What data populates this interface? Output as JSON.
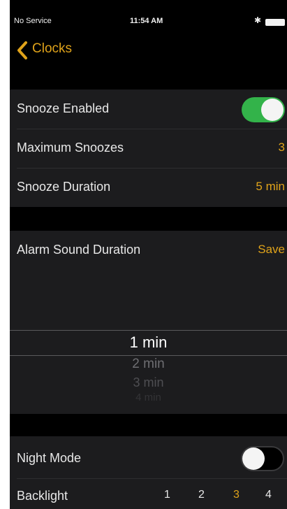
{
  "status_bar": {
    "carrier": "No Service",
    "time": "11:54 AM",
    "bluetooth_icon": "bluetooth-icon",
    "battery_icon": "battery-icon"
  },
  "nav": {
    "back_label": "Clocks",
    "back_icon": "chevron-left-icon"
  },
  "snooze": {
    "enabled_label": "Snooze Enabled",
    "enabled": true,
    "max_label": "Maximum Snoozes",
    "max_value": "3",
    "duration_label": "Snooze Duration",
    "duration_value": "5 min"
  },
  "alarm_sound": {
    "label": "Alarm Sound Duration",
    "save_label": "Save",
    "picker_options": [
      "1 min",
      "2 min",
      "3 min",
      "4 min"
    ],
    "selected": "1 min"
  },
  "display": {
    "night_mode_label": "Night Mode",
    "night_mode": false,
    "backlight_label": "Backlight",
    "backlight_levels": [
      "1",
      "2",
      "3",
      "4"
    ],
    "backlight_selected": "3"
  },
  "colors": {
    "accent": "#e0a31a",
    "toggle_on": "#33b34a",
    "background": "#000000",
    "cell_background": "#1c1c1e"
  }
}
